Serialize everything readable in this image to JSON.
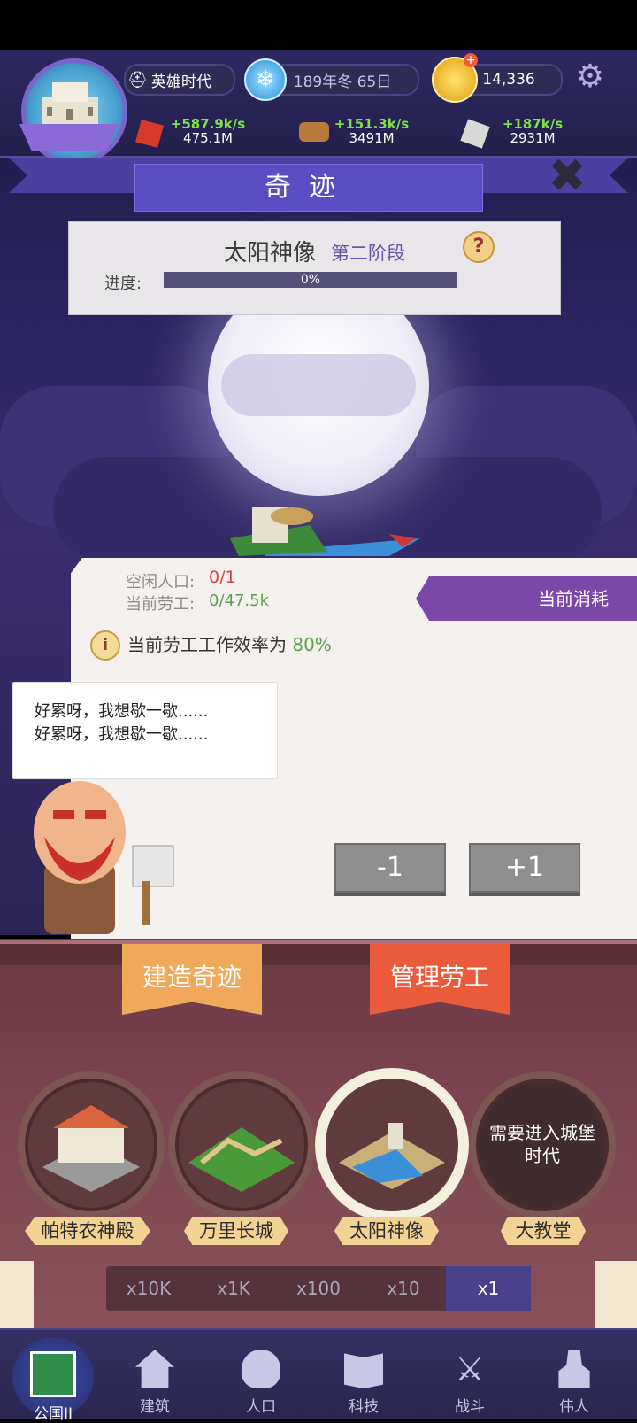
{
  "hud": {
    "era": "英雄时代",
    "date": "189年冬 65日",
    "coins": "14,336",
    "resources": [
      {
        "name": "red-resource",
        "rate": "+587.9k/s",
        "total": "475.1M"
      },
      {
        "name": "wood-resource",
        "rate": "+151.3k/s",
        "total": "3491M"
      },
      {
        "name": "stone-resource",
        "rate": "+187k/s",
        "total": "2931M"
      }
    ]
  },
  "title": "奇迹",
  "wonder": {
    "name": "太阳神像",
    "stage": "第二阶段",
    "progress_label": "进度:",
    "progress_text": "0%",
    "progress_value": 0
  },
  "labor": {
    "idle_label": "空闲人口:",
    "idle_value": "0/1",
    "workers_label": "当前劳工:",
    "workers_value": "0/47.5k",
    "efficiency_text": "当前劳工工作效率为",
    "efficiency_value": "80%",
    "consume_label": "当前消耗",
    "speech_line1": "好累呀，我想歇一歇......",
    "speech_line2": "好累呀，我想歇一歇......",
    "minus_label": "-1",
    "plus_label": "+1"
  },
  "tabs": {
    "build": "建造奇迹",
    "manage": "管理劳工"
  },
  "wonders": [
    {
      "label": "帕特农神殿"
    },
    {
      "label": "万里长城"
    },
    {
      "label": "太阳神像"
    },
    {
      "label": "大教堂",
      "locked_text": "需要进入城堡时代"
    }
  ],
  "multipliers": [
    "x10K",
    "x1K",
    "x100",
    "x10",
    "x1"
  ],
  "nav": [
    "公国II",
    "建筑",
    "人口",
    "科技",
    "战斗",
    "伟人"
  ],
  "colors": {
    "accent": "#5a4cc2",
    "rate_green": "#7de34a",
    "tab_build": "#f0a85a",
    "tab_manage": "#ea5b3c"
  }
}
